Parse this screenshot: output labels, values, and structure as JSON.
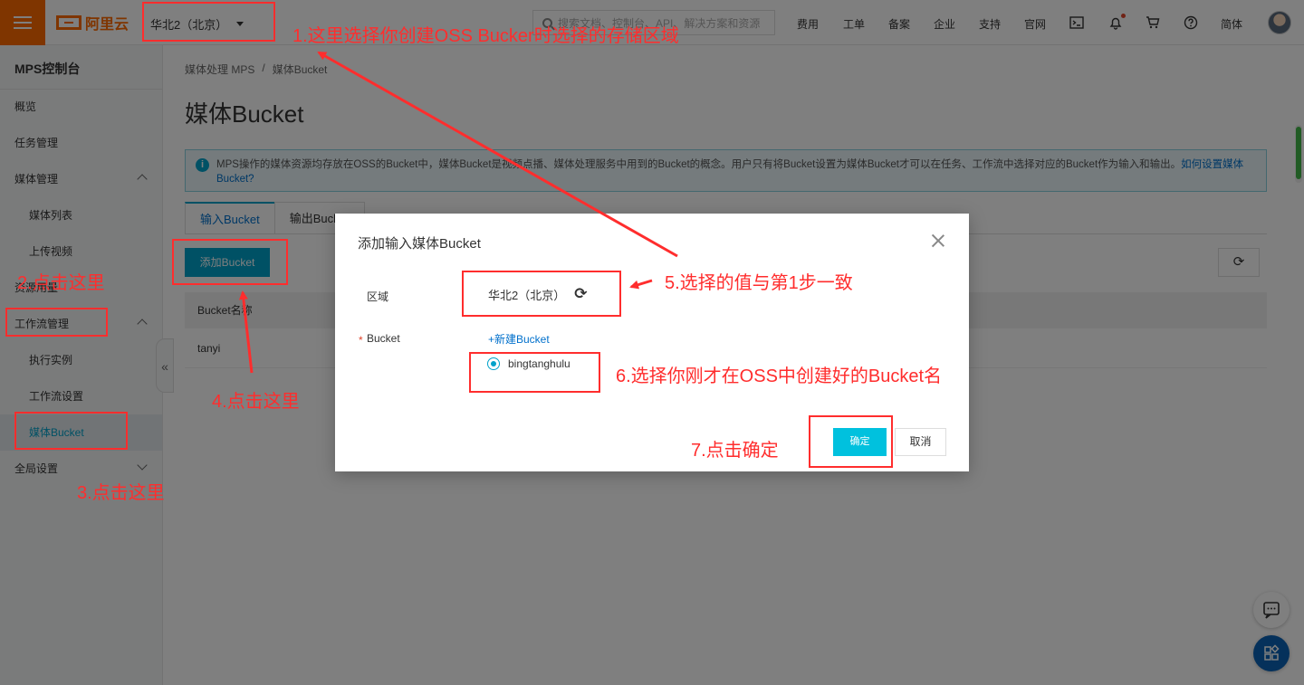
{
  "topbar": {
    "region": "华北2（北京）",
    "search_placeholder": "搜索文档、控制台、API、解决方案和资源",
    "nav": [
      "费用",
      "工单",
      "备案",
      "企业",
      "支持",
      "官网"
    ],
    "lang": "简体",
    "logo_text": "阿里云"
  },
  "sidebar": {
    "title": "MPS控制台",
    "items": [
      "概览",
      "任务管理",
      "媒体管理",
      "媒体列表",
      "上传视频",
      "资源用量",
      "工作流管理",
      "执行实例",
      "工作流设置",
      "媒体Bucket",
      "全局设置"
    ]
  },
  "main": {
    "breadcrumb": [
      "媒体处理 MPS",
      "/",
      "媒体Bucket"
    ],
    "title": "媒体Bucket",
    "info_text": "MPS操作的媒体资源均存放在OSS的Bucket中，媒体Bucket是视频点播、媒体处理服务中用到的Bucket的概念。用户只有将Bucket设置为媒体Bucket才可以在任务、工作流中选择对应的Bucket作为输入和输出。",
    "info_link": "如何设置媒体Bucket?",
    "tabs": [
      "输入Bucket",
      "输出Bucket"
    ],
    "add_button": "添加Bucket",
    "table_header": "Bucket名称",
    "table_rows": [
      "tanyi"
    ]
  },
  "dialog": {
    "title": "添加输入媒体Bucket",
    "region_label": "区域",
    "region_value": "华北2（北京）",
    "bucket_label": "Bucket",
    "required_mark": "*",
    "new_bucket": "+新建Bucket",
    "bucket_option": "bingtanghulu",
    "ok": "确定",
    "cancel": "取消"
  },
  "annotations": {
    "step1": "1.这里选择你创建OSS Bucker时选择的存储区域",
    "step2": "2.点击这里",
    "step3": "3.点击这里",
    "step4": "4.点击这里",
    "step5": "5.选择的值与第1步一致",
    "step6": "6.选择你刚才在OSS中创建好的Bucket名",
    "step7": "7.点击确定",
    "color": "#ff2d2d"
  },
  "colors": {
    "brand": "#ff6a00",
    "accent": "#00a2ca",
    "ok_button": "#00c1de",
    "link": "#0070cc"
  }
}
